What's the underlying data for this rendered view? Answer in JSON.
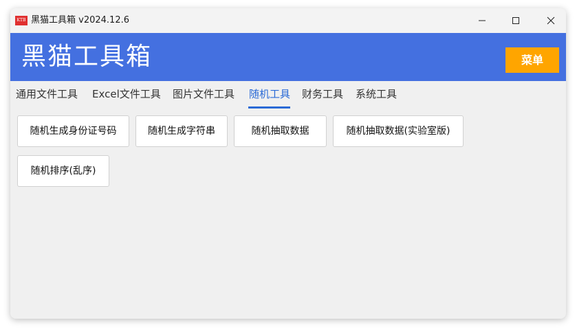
{
  "window": {
    "icon_text": "KTB",
    "title": "黑猫工具箱 v2024.12.6",
    "minimize_glyph": "—",
    "maximize_glyph": "☐",
    "close_glyph": "✕"
  },
  "banner": {
    "title": "黑猫工具箱",
    "menu_label": "菜单",
    "background_color": "#4470e0",
    "menu_color": "#ffa500"
  },
  "tabs": [
    {
      "label": "通用文件工具",
      "active": false
    },
    {
      "label": "Excel文件工具",
      "active": false
    },
    {
      "label": "图片文件工具",
      "active": false
    },
    {
      "label": "随机工具",
      "active": true
    },
    {
      "label": "财务工具",
      "active": false
    },
    {
      "label": "系统工具",
      "active": false
    }
  ],
  "tools": [
    {
      "label": "随机生成身份证号码"
    },
    {
      "label": "随机生成字符串"
    },
    {
      "label": "随机抽取数据"
    },
    {
      "label": "随机抽取数据(实验室版)"
    },
    {
      "label": "随机排序(乱序)"
    }
  ]
}
